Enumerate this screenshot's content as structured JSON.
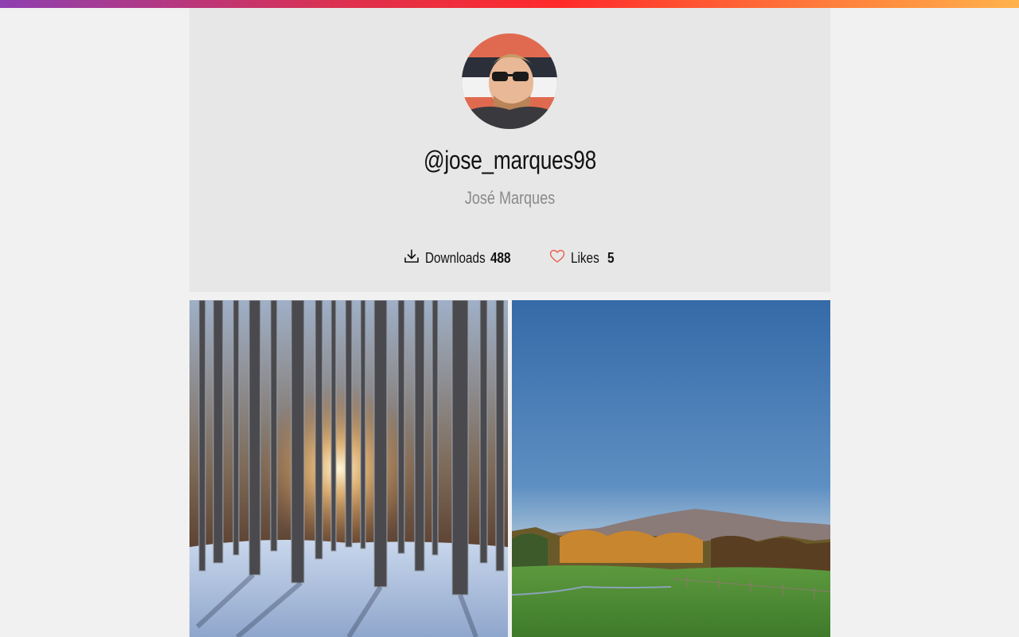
{
  "profile": {
    "username": "@jose_marques98",
    "full_name": "José Marques",
    "avatar_alt": "avatar"
  },
  "stats": {
    "downloads_label": "Downloads",
    "downloads_value": "488",
    "likes_label": "Likes",
    "likes_value": "5"
  },
  "icons": {
    "downloads": "download-icon",
    "likes": "heart-icon"
  },
  "colors": {
    "background": "#f1f1f1",
    "card": "#e7e7e7",
    "likes_accent": "#e8604c",
    "gradient": [
      "#8e3fb0",
      "#e0304c",
      "#ff2a2a",
      "#ff7a3a",
      "#ffb24c"
    ]
  },
  "photos": [
    {
      "subject": "snowy pine forest with sunlight"
    },
    {
      "subject": "mountain and autumn trees under blue sky"
    }
  ]
}
